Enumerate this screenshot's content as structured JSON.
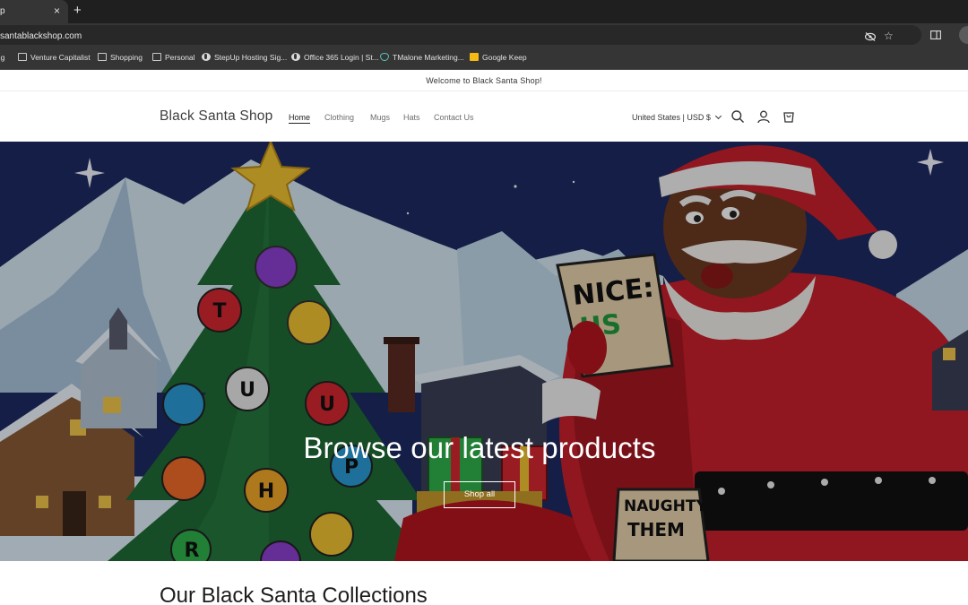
{
  "browser": {
    "tab_title": "p",
    "tab_close": "×",
    "new_tab": "+",
    "url": "santablackshop.com",
    "star_glyph": "☆",
    "bookmarks": [
      {
        "label": "ing",
        "icon": "folder-icon"
      },
      {
        "label": "Venture Capitalist",
        "icon": "folder-icon"
      },
      {
        "label": "Shopping",
        "icon": "folder-icon"
      },
      {
        "label": "Personal",
        "icon": "folder-icon"
      },
      {
        "label": "StepUp Hosting Sig...",
        "icon": "globe-icon"
      },
      {
        "label": "Office 365 Login | St...",
        "icon": "globe-icon"
      },
      {
        "label": "TMalone Marketing...",
        "icon": "heart-icon"
      },
      {
        "label": "Google Keep",
        "icon": "keep-icon"
      }
    ]
  },
  "announcement": "Welcome to Black Santa Shop!",
  "header": {
    "logo": "Black Santa Shop",
    "nav": [
      "Home",
      "Clothing",
      "Mugs",
      "Hats",
      "Contact Us"
    ],
    "active_nav": "Home",
    "locale": "United States | USD $",
    "icons": [
      "search-icon",
      "account-icon",
      "cart-icon"
    ]
  },
  "hero": {
    "heading": "Browse our latest products",
    "button": "Shop all",
    "sign_nice_line1": "NICE:",
    "sign_nice_line2": "US",
    "sign_naughty_line1": "NAUGHTY:",
    "sign_naughty_line2": "THEM",
    "ornament_letters": [
      "T",
      "U",
      "U",
      "P",
      "H",
      "R"
    ]
  },
  "collections": {
    "title": "Our Black Santa Collections"
  },
  "colors": {
    "sky": "#1b2456",
    "mountain": "#d6e8f3",
    "tree": "#1f6b36",
    "santa_suit": "#c8202b",
    "skin": "#6b3a22",
    "gold": "#f1c232"
  }
}
